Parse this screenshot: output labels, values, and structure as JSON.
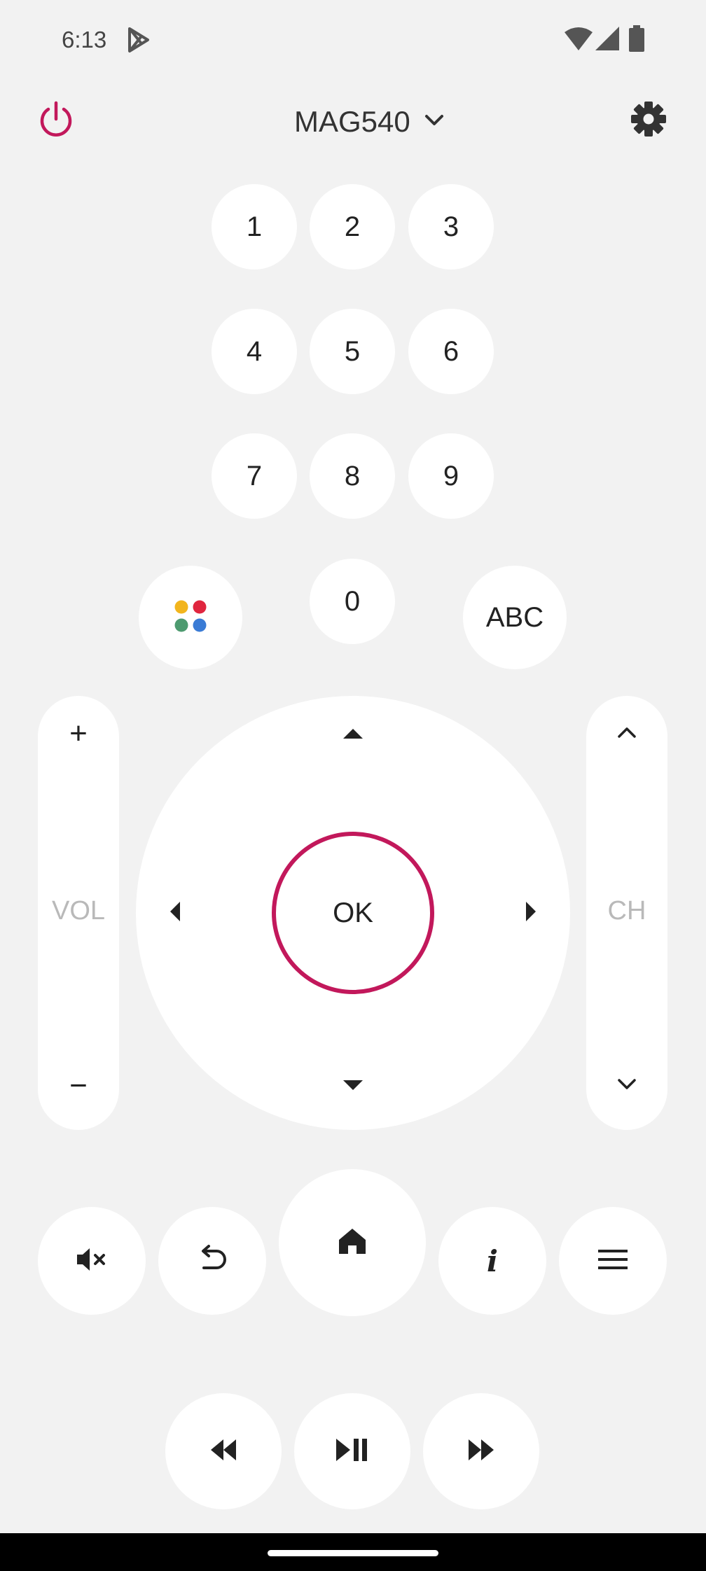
{
  "status_bar": {
    "time": "6:13",
    "icons": [
      "play-store-icon",
      "wifi-icon",
      "cell-signal-icon",
      "battery-icon"
    ]
  },
  "header": {
    "device_name": "MAG540",
    "power_icon": "power-icon",
    "dropdown_icon": "chevron-down-icon",
    "settings_icon": "gear-icon"
  },
  "keypad": {
    "digits": [
      "1",
      "2",
      "3",
      "4",
      "5",
      "6",
      "7",
      "8",
      "9",
      "0"
    ],
    "color_buttons_icon": "color-dots-icon",
    "abc_label": "ABC"
  },
  "volume": {
    "label": "VOL",
    "plus": "+",
    "minus": "−"
  },
  "channel": {
    "label": "CH",
    "up_icon": "chevron-up-icon",
    "down_icon": "chevron-down-icon"
  },
  "dpad": {
    "ok_label": "OK"
  },
  "bottom_row": {
    "icons": [
      "mute-icon",
      "back-icon",
      "home-icon",
      "info-icon",
      "menu-icon"
    ],
    "info_label": "i"
  },
  "media_row": {
    "icons": [
      "rewind-icon",
      "play-pause-icon",
      "fast-forward-icon"
    ]
  },
  "colors": {
    "accent": "#c2185b",
    "background": "#f2f2f2",
    "button": "#ffffff",
    "dot_yellow": "#f2b51d",
    "dot_red": "#e0263f",
    "dot_green": "#4d9a6f",
    "dot_blue": "#3a7bd5"
  }
}
